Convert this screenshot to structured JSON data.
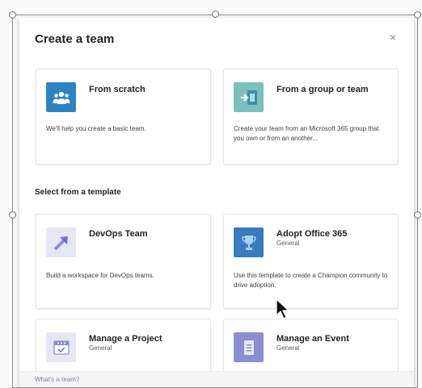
{
  "dialog": {
    "title": "Create a team",
    "close_label": "×"
  },
  "top_options": [
    {
      "title": "From scratch",
      "description": "We'll help you create a basic team.",
      "icon": "team-people-icon",
      "icon_bg": "#2f82c0"
    },
    {
      "title": "From a group or team",
      "description": "Create your team from an Microsoft 365 group that you own or from an another...",
      "icon": "group-arrow-icon",
      "icon_bg": "#5fa7a6"
    }
  ],
  "section_label": "Select from a template",
  "templates": [
    {
      "title": "DevOps Team",
      "subtitle": "",
      "description": "Build a workspace for DevOps teams.",
      "icon": "devops-arrow-icon",
      "icon_bg": "#e7e6f6"
    },
    {
      "title": "Adopt Office 365",
      "subtitle": "General",
      "description": "Use this template to create a Champion community to drive adoption.",
      "icon": "trophy-icon",
      "icon_bg": "#3a7bbf"
    },
    {
      "title": "Manage a Project",
      "subtitle": "General",
      "description": "",
      "icon": "project-board-icon",
      "icon_bg": "#e7e6f6"
    },
    {
      "title": "Manage an Event",
      "subtitle": "General",
      "description": "",
      "icon": "event-document-icon",
      "icon_bg": "#8b8fd0"
    }
  ],
  "footer": {
    "link": "What's a team?"
  }
}
